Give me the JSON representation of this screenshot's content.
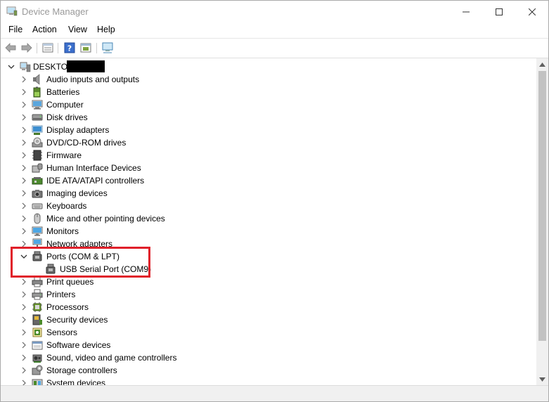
{
  "window": {
    "title": "Device Manager",
    "accent": "#e0202a"
  },
  "menu": {
    "file": "File",
    "action": "Action",
    "view": "View",
    "help": "Help"
  },
  "toolbar": {
    "icons": [
      "back-icon",
      "forward-icon",
      "properties-icon",
      "help-icon",
      "update-driver-icon",
      "scan-hardware-icon"
    ]
  },
  "tree": {
    "root": "DESKTOP",
    "categories": [
      {
        "label": "Audio inputs and outputs",
        "icon": "speaker-icon"
      },
      {
        "label": "Batteries",
        "icon": "battery-icon"
      },
      {
        "label": "Computer",
        "icon": "computer-icon"
      },
      {
        "label": "Disk drives",
        "icon": "disk-icon"
      },
      {
        "label": "Display adapters",
        "icon": "display-adapter-icon"
      },
      {
        "label": "DVD/CD-ROM drives",
        "icon": "dvd-icon"
      },
      {
        "label": "Firmware",
        "icon": "firmware-icon"
      },
      {
        "label": "Human Interface Devices",
        "icon": "hid-icon"
      },
      {
        "label": "IDE ATA/ATAPI controllers",
        "icon": "ide-icon"
      },
      {
        "label": "Imaging devices",
        "icon": "camera-icon"
      },
      {
        "label": "Keyboards",
        "icon": "keyboard-icon"
      },
      {
        "label": "Mice and other pointing devices",
        "icon": "mouse-icon"
      },
      {
        "label": "Monitors",
        "icon": "monitor-icon"
      },
      {
        "label": "Network adapters",
        "icon": "network-icon"
      },
      {
        "label": "Ports (COM & LPT)",
        "icon": "port-icon",
        "expanded": true
      },
      {
        "label": "USB Serial Port (COM9)",
        "icon": "port-icon",
        "child": true
      },
      {
        "label": "Print queues",
        "icon": "print-queue-icon"
      },
      {
        "label": "Printers",
        "icon": "printer-icon"
      },
      {
        "label": "Processors",
        "icon": "processor-icon"
      },
      {
        "label": "Security devices",
        "icon": "security-icon"
      },
      {
        "label": "Sensors",
        "icon": "sensor-icon"
      },
      {
        "label": "Software devices",
        "icon": "software-icon"
      },
      {
        "label": "Sound, video and game controllers",
        "icon": "sound-icon"
      },
      {
        "label": "Storage controllers",
        "icon": "storage-icon"
      },
      {
        "label": "System devices",
        "icon": "system-icon"
      }
    ]
  }
}
